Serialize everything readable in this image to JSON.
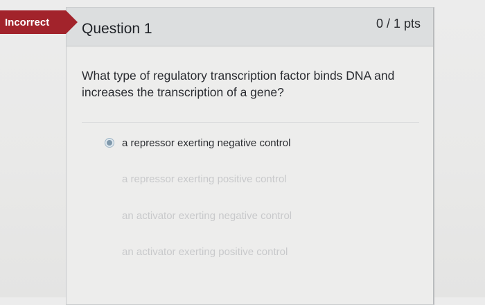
{
  "status": {
    "badge": "Incorrect"
  },
  "question": {
    "title": "Question 1",
    "points": "0 / 1 pts",
    "text": "What type of regulatory transcription factor binds DNA and increases the transcription of a gene?"
  },
  "answers": [
    {
      "label": "a repressor exerting negative control",
      "selected": true
    },
    {
      "label": "a repressor exerting positive control",
      "selected": false
    },
    {
      "label": "an activator exerting negative control",
      "selected": false
    },
    {
      "label": "an activator exerting positive control",
      "selected": false
    }
  ],
  "colors": {
    "incorrect_badge": "#a2232b",
    "header_bg": "#dcdedf",
    "selected_radio": "#7f98ab"
  }
}
